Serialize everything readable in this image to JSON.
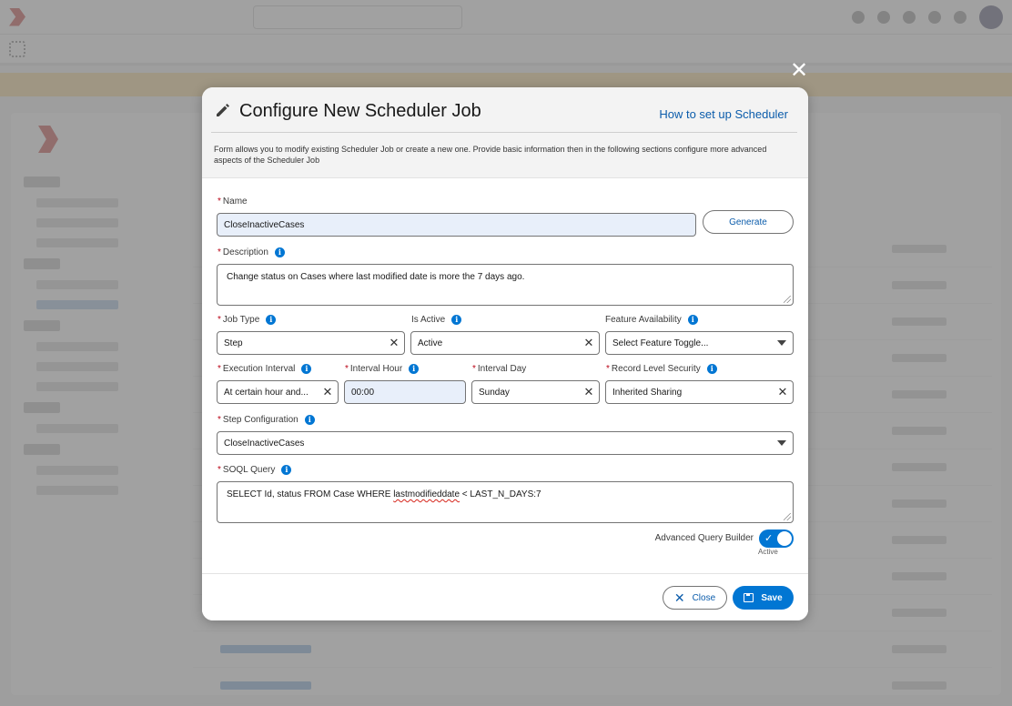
{
  "modal": {
    "title": "Configure New Scheduler Job",
    "help_link": "How to set up Scheduler",
    "description": "Form allows you to modify existing Scheduler Job or create a new one. Provide basic information then in the following sections configure more advanced aspects of the Scheduler Job",
    "close_icon": "close-icon"
  },
  "form": {
    "name": {
      "label": "Name",
      "value": "CloseInactiveCases",
      "required": true
    },
    "generate_button": "Generate",
    "description": {
      "label": "Description",
      "value": "Change status on Cases where last modified date is more the 7 days ago.",
      "required": true
    },
    "job_type": {
      "label": "Job Type",
      "value": "Step",
      "required": true
    },
    "is_active": {
      "label": "Is Active",
      "value": "Active"
    },
    "feature_availability": {
      "label": "Feature Availability",
      "placeholder": "Select Feature Toggle..."
    },
    "execution_interval": {
      "label": "Execution Interval",
      "value": "At certain hour and...",
      "required": true
    },
    "interval_hour": {
      "label": "Interval Hour",
      "value": "00:00",
      "required": true
    },
    "interval_day": {
      "label": "Interval Day",
      "value": "Sunday",
      "required": true
    },
    "record_level_security": {
      "label": "Record Level Security",
      "value": "Inherited Sharing",
      "required": true
    },
    "step_configuration": {
      "label": "Step Configuration",
      "value": "CloseInactiveCases",
      "required": true
    },
    "soql_query": {
      "label": "SOQL Query",
      "value_before": "SELECT Id, status FROM Case WHERE ",
      "value_misspelled": "lastmodifieddate",
      "value_after": " < LAST_N_DAYS:7",
      "required": true
    },
    "advanced_query_builder": {
      "label": "Advanced Query Builder",
      "state": "Active",
      "checked": true
    }
  },
  "footer": {
    "close_label": "Close",
    "save_label": "Save"
  },
  "icons": {
    "info": "i",
    "required_marker": "*",
    "clear": "✕",
    "close": "✕",
    "check": "✓"
  },
  "colors": {
    "brand": "#0176d3",
    "link": "#0b5cab",
    "required": "#ba0517",
    "filled_field": "#e8effa"
  }
}
